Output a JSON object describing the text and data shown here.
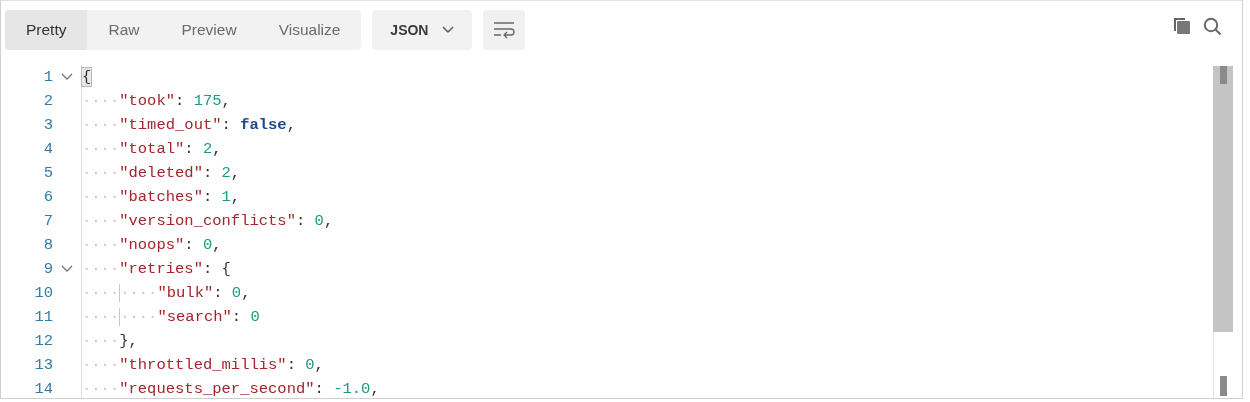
{
  "view_tabs": [
    {
      "label": "Pretty",
      "selected": true
    },
    {
      "label": "Raw",
      "selected": false
    },
    {
      "label": "Preview",
      "selected": false
    },
    {
      "label": "Visualize",
      "selected": false
    }
  ],
  "format_dropdown": {
    "value": "JSON"
  },
  "lines": [
    {
      "number": "1",
      "foldable": true,
      "expanded": true,
      "tokens": [
        {
          "kind": "bracket",
          "text": "{",
          "matched": true
        }
      ]
    },
    {
      "number": "2",
      "tokens": [
        {
          "kind": "indent",
          "text": "····"
        },
        {
          "kind": "key",
          "text": "\"took\""
        },
        {
          "kind": "punct",
          "text": ": "
        },
        {
          "kind": "number",
          "text": "175"
        },
        {
          "kind": "punct",
          "text": ","
        }
      ]
    },
    {
      "number": "3",
      "tokens": [
        {
          "kind": "indent",
          "text": "····"
        },
        {
          "kind": "key",
          "text": "\"timed_out\""
        },
        {
          "kind": "punct",
          "text": ": "
        },
        {
          "kind": "boolean",
          "text": "false"
        },
        {
          "kind": "punct",
          "text": ","
        }
      ]
    },
    {
      "number": "4",
      "tokens": [
        {
          "kind": "indent",
          "text": "····"
        },
        {
          "kind": "key",
          "text": "\"total\""
        },
        {
          "kind": "punct",
          "text": ": "
        },
        {
          "kind": "number",
          "text": "2"
        },
        {
          "kind": "punct",
          "text": ","
        }
      ]
    },
    {
      "number": "5",
      "tokens": [
        {
          "kind": "indent",
          "text": "····"
        },
        {
          "kind": "key",
          "text": "\"deleted\""
        },
        {
          "kind": "punct",
          "text": ": "
        },
        {
          "kind": "number",
          "text": "2"
        },
        {
          "kind": "punct",
          "text": ","
        }
      ]
    },
    {
      "number": "6",
      "tokens": [
        {
          "kind": "indent",
          "text": "····"
        },
        {
          "kind": "key",
          "text": "\"batches\""
        },
        {
          "kind": "punct",
          "text": ": "
        },
        {
          "kind": "number",
          "text": "1"
        },
        {
          "kind": "punct",
          "text": ","
        }
      ]
    },
    {
      "number": "7",
      "tokens": [
        {
          "kind": "indent",
          "text": "····"
        },
        {
          "kind": "key",
          "text": "\"version_conflicts\""
        },
        {
          "kind": "punct",
          "text": ": "
        },
        {
          "kind": "number",
          "text": "0"
        },
        {
          "kind": "punct",
          "text": ","
        }
      ]
    },
    {
      "number": "8",
      "tokens": [
        {
          "kind": "indent",
          "text": "····"
        },
        {
          "kind": "key",
          "text": "\"noops\""
        },
        {
          "kind": "punct",
          "text": ": "
        },
        {
          "kind": "number",
          "text": "0"
        },
        {
          "kind": "punct",
          "text": ","
        }
      ]
    },
    {
      "number": "9",
      "foldable": true,
      "expanded": true,
      "tokens": [
        {
          "kind": "indent",
          "text": "····"
        },
        {
          "kind": "key",
          "text": "\"retries\""
        },
        {
          "kind": "punct",
          "text": ": "
        },
        {
          "kind": "bracket",
          "text": "{",
          "matched": false
        }
      ]
    },
    {
      "number": "10",
      "tokens": [
        {
          "kind": "indent",
          "text": "····"
        },
        {
          "kind": "guide-indent",
          "text": "····"
        },
        {
          "kind": "key",
          "text": "\"bulk\""
        },
        {
          "kind": "punct",
          "text": ": "
        },
        {
          "kind": "number",
          "text": "0"
        },
        {
          "kind": "punct",
          "text": ","
        }
      ]
    },
    {
      "number": "11",
      "tokens": [
        {
          "kind": "indent",
          "text": "····"
        },
        {
          "kind": "guide-indent",
          "text": "····"
        },
        {
          "kind": "key",
          "text": "\"search\""
        },
        {
          "kind": "punct",
          "text": ": "
        },
        {
          "kind": "number",
          "text": "0"
        }
      ]
    },
    {
      "number": "12",
      "tokens": [
        {
          "kind": "indent",
          "text": "····"
        },
        {
          "kind": "bracket",
          "text": "}",
          "matched": false
        },
        {
          "kind": "punct",
          "text": ","
        }
      ]
    },
    {
      "number": "13",
      "tokens": [
        {
          "kind": "indent",
          "text": "····"
        },
        {
          "kind": "key",
          "text": "\"throttled_millis\""
        },
        {
          "kind": "punct",
          "text": ": "
        },
        {
          "kind": "number",
          "text": "0"
        },
        {
          "kind": "punct",
          "text": ","
        }
      ]
    },
    {
      "number": "14",
      "tokens": [
        {
          "kind": "indent",
          "text": "····"
        },
        {
          "kind": "key",
          "text": "\"requests_per_second\""
        },
        {
          "kind": "punct",
          "text": ": "
        },
        {
          "kind": "number",
          "text": "-1.0"
        },
        {
          "kind": "punct",
          "text": ","
        }
      ]
    }
  ]
}
